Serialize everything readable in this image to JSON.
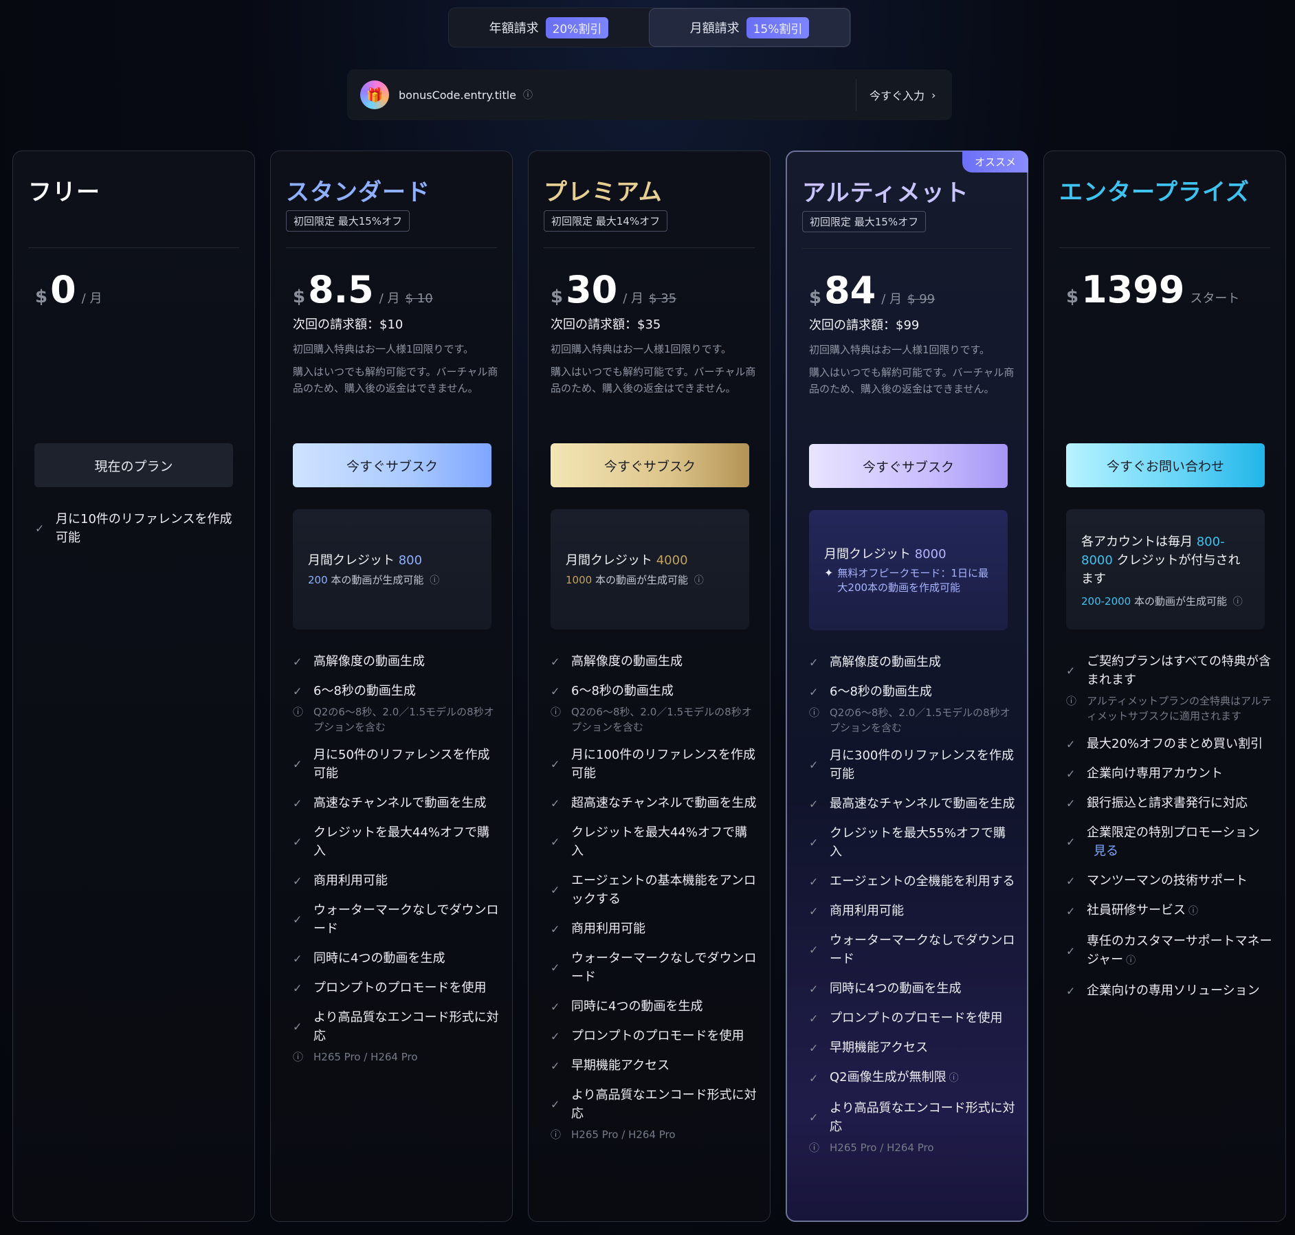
{
  "billing": {
    "annual_label": "年額請求",
    "annual_badge": "20%割引",
    "monthly_label": "月額請求",
    "monthly_badge": "15%割引"
  },
  "bonus": {
    "title": "bonusCode.entry.title",
    "enter_label": "今すぐ入力"
  },
  "icons": {
    "info": "ⓘ",
    "check": "✓",
    "chevron": "›",
    "sparkle": "✦",
    "gift": "🎁"
  },
  "colors": {
    "standard_title": "#8fb0ff",
    "premium_title": "#e7cf94",
    "ultimate_title": "#c9c4ff",
    "enterprise_title": "#3ec2f0",
    "accent_blue": "#7aa7ff"
  },
  "free": {
    "name": "フリー",
    "currency": "$",
    "price": "0",
    "per": "/ 月",
    "cta": "現在のプラン",
    "features": [
      "月に10件のリファレンスを作成可能"
    ]
  },
  "standard": {
    "name": "スタンダード",
    "promo": "初回限定 最大15%オフ",
    "currency": "$",
    "price": "8.5",
    "per": "/ 月",
    "old_price": "$ 10",
    "next_bill": "次回の請求額：$10",
    "note1": "初回購入特典はお一人様1回限りです。",
    "note2": "購入はいつでも解約可能です。バーチャル商品のため、購入後の返金はできません。",
    "cta": "今すぐサブスク",
    "credit_label": "月間クレジット",
    "credit_value": "800",
    "videos_value": "200",
    "videos_label": "本の動画が生成可能",
    "features": [
      "高解像度の動画生成",
      "6～8秒の動画生成",
      "Q2の6～8秒、2.0／1.5モデルの8秒オプションを含む",
      "月に50件のリファレンスを作成可能",
      "高速なチャンネルで動画を生成",
      "クレジットを最大44%オフで購入",
      "商用利用可能",
      "ウォーターマークなしでダウンロード",
      "同時に4つの動画を生成",
      "プロンプトのプロモードを使用",
      "より高品質なエンコード形式に対応",
      "H265 Pro / H264 Pro"
    ]
  },
  "premium": {
    "name": "プレミアム",
    "promo": "初回限定 最大14%オフ",
    "currency": "$",
    "price": "30",
    "per": "/ 月",
    "old_price": "$ 35",
    "next_bill": "次回の請求額：$35",
    "note1": "初回購入特典はお一人様1回限りです。",
    "note2": "購入はいつでも解約可能です。バーチャル商品のため、購入後の返金はできません。",
    "cta": "今すぐサブスク",
    "credit_label": "月間クレジット",
    "credit_value": "4000",
    "videos_value": "1000",
    "videos_label": "本の動画が生成可能",
    "features": [
      "高解像度の動画生成",
      "6～8秒の動画生成",
      "Q2の6～8秒、2.0／1.5モデルの8秒オプションを含む",
      "月に100件のリファレンスを作成可能",
      "超高速なチャンネルで動画を生成",
      "クレジットを最大44%オフで購入",
      "エージェントの基本機能をアンロックする",
      "商用利用可能",
      "ウォーターマークなしでダウンロード",
      "同時に4つの動画を生成",
      "プロンプトのプロモードを使用",
      "早期機能アクセス",
      "より高品質なエンコード形式に対応",
      "H265 Pro / H264 Pro"
    ]
  },
  "ultimate": {
    "name": "アルティメット",
    "badge": "オススメ",
    "promo": "初回限定 最大15%オフ",
    "currency": "$",
    "price": "84",
    "per": "/ 月",
    "old_price": "$ 99",
    "next_bill": "次回の請求額：$99",
    "note1": "初回購入特典はお一人様1回限りです。",
    "note2": "購入はいつでも解約可能です。バーチャル商品のため、購入後の返金はできません。",
    "cta": "今すぐサブスク",
    "credit_label": "月間クレジット",
    "credit_value": "8000",
    "offpeak": "無料オフピークモード：1日に最大200本の動画を作成可能",
    "features": [
      "高解像度の動画生成",
      "6～8秒の動画生成",
      "Q2の6～8秒、2.0／1.5モデルの8秒オプションを含む",
      "月に300件のリファレンスを作成可能",
      "最高速なチャンネルで動画を生成",
      "クレジットを最大55%オフで購入",
      "エージェントの全機能を利用する",
      "商用利用可能",
      "ウォーターマークなしでダウンロード",
      "同時に4つの動画を生成",
      "プロンプトのプロモードを使用",
      "早期機能アクセス",
      "Q2画像生成が無制限",
      "より高品質なエンコード形式に対応",
      "H265 Pro / H264 Pro"
    ]
  },
  "enterprise": {
    "name": "エンタープライズ",
    "currency": "$",
    "price": "1399",
    "per": "スタート",
    "cta": "今すぐお問い合わせ",
    "credit_pre": "各アカウントは毎月",
    "credit_value": "800-8000",
    "credit_post": "クレジットが付与されます",
    "videos_value": "200-2000",
    "videos_label": "本の動画が生成可能",
    "features": [
      "ご契約プランはすべての特典が含まれます",
      "アルティメットプランの全特典はアルティメットサブスクに適用されます",
      "最大20%オフのまとめ買い割引",
      "企業向け専用アカウント",
      "銀行振込と請求書発行に対応",
      "企業限定の特別プロモーション",
      "見る",
      "マンツーマンの技術サポート",
      "社員研修サービス",
      "専任のカスタマーサポートマネージャー",
      "企業向けの専用ソリューション"
    ]
  }
}
